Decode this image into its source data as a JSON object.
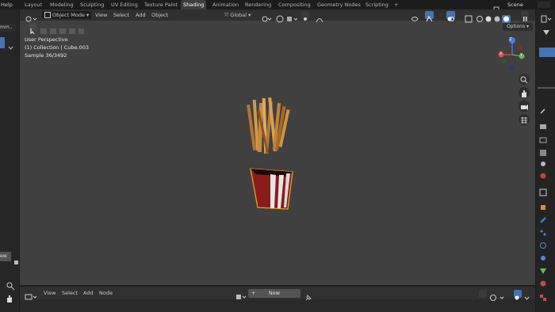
{
  "topbar": {
    "help": "Help",
    "tabs": [
      "Layout",
      "Modeling",
      "Sculpting",
      "UV Editing",
      "Texture Paint",
      "Shading",
      "Animation",
      "Rendering",
      "Compositing",
      "Geometry Nodes",
      "Scripting"
    ],
    "active_tab": "Shading",
    "add_tab": "+",
    "scene": "Scene"
  },
  "viewport": {
    "mode": "Object Mode",
    "menus": [
      "View",
      "Select",
      "Add",
      "Object"
    ],
    "transform_orientation": "Global",
    "options": "Options",
    "overlay": {
      "perspective": "User Perspective",
      "collection": "(1) Collection | Cube.003",
      "sample": "Sample 36/3492"
    }
  },
  "left": {
    "item_label": "mm..",
    "new_label": "ew"
  },
  "node_editor": {
    "menus": [
      "View",
      "Select",
      "Add",
      "Node"
    ],
    "new_button": "New"
  },
  "gizmo": {
    "z": "Z",
    "x": "X",
    "y": "Y"
  },
  "colors": {
    "accent": "#4772b3",
    "viewport_bg": "#404040",
    "box_red": "#8b1a1a",
    "fries": "#c98a3a"
  }
}
